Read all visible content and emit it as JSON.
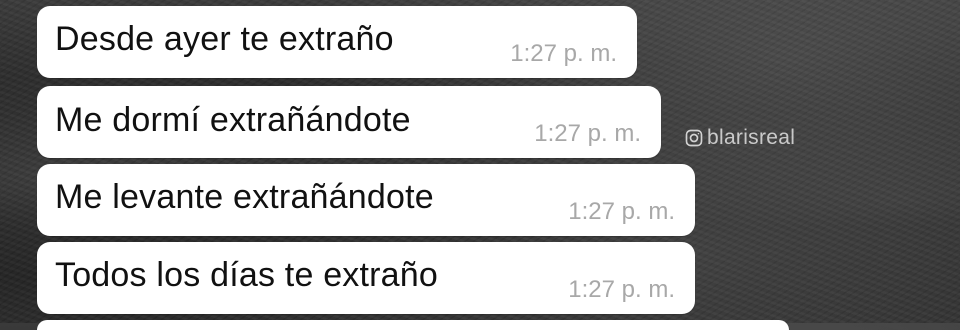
{
  "chat": {
    "messages": [
      {
        "text": "Desde ayer te extraño",
        "time": "1:27 p. m."
      },
      {
        "text": "Me dormí extrañándote",
        "time": "1:27 p. m."
      },
      {
        "text": "Me levante extrañándote",
        "time": "1:27 p. m."
      },
      {
        "text": "Todos los días te extraño",
        "time": "1:27 p. m."
      }
    ]
  },
  "watermark": {
    "icon": "instagram-icon",
    "handle": "blarisreal"
  },
  "colors": {
    "bubble": "#ffffff",
    "message_text": "#111111",
    "timestamp": "#a8a8a8",
    "background": "#262626"
  }
}
